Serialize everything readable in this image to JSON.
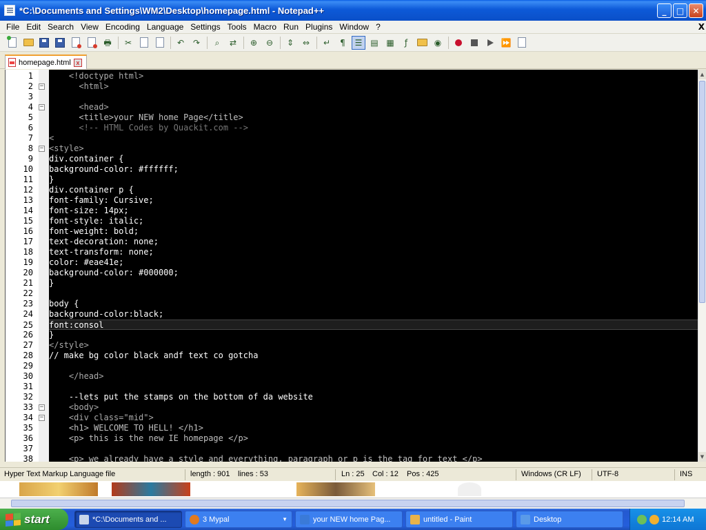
{
  "window": {
    "title": "*C:\\Documents and Settings\\WM2\\Desktop\\homepage.html - Notepad++",
    "min_glyph": "_",
    "max_glyph": "□",
    "close_glyph": "✕"
  },
  "menu": {
    "items": [
      "File",
      "Edit",
      "Search",
      "View",
      "Encoding",
      "Language",
      "Settings",
      "Tools",
      "Macro",
      "Run",
      "Plugins",
      "Window",
      "?"
    ],
    "close_glyph": "X"
  },
  "tab": {
    "label": "homepage.html",
    "close_glyph": "x"
  },
  "editor": {
    "lines": [
      {
        "n": "1",
        "fold": "",
        "text": "    <!doctype html>",
        "cls": "tag"
      },
      {
        "n": "2",
        "fold": "−",
        "text": "      <html>",
        "cls": "tag"
      },
      {
        "n": "3",
        "fold": "",
        "text": "      ",
        "cls": ""
      },
      {
        "n": "4",
        "fold": "−",
        "text": "      <head>",
        "cls": "tag"
      },
      {
        "n": "5",
        "fold": "",
        "text": "      <title>your NEW home Page</title>",
        "cls": "mix-title"
      },
      {
        "n": "6",
        "fold": "",
        "text": "      <!-- HTML Codes by Quackit.com -->",
        "cls": "cmt"
      },
      {
        "n": "7",
        "fold": "",
        "text": "<",
        "cls": "tag"
      },
      {
        "n": "8",
        "fold": "−",
        "text": "<style>",
        "cls": "tag"
      },
      {
        "n": "9",
        "fold": "",
        "text": "div.container {",
        "cls": ""
      },
      {
        "n": "10",
        "fold": "",
        "text": "background-color: #ffffff;",
        "cls": ""
      },
      {
        "n": "11",
        "fold": "",
        "text": "}",
        "cls": ""
      },
      {
        "n": "12",
        "fold": "",
        "text": "div.container p {",
        "cls": ""
      },
      {
        "n": "13",
        "fold": "",
        "text": "font-family: Cursive;",
        "cls": ""
      },
      {
        "n": "14",
        "fold": "",
        "text": "font-size: 14px;",
        "cls": ""
      },
      {
        "n": "15",
        "fold": "",
        "text": "font-style: italic;",
        "cls": ""
      },
      {
        "n": "16",
        "fold": "",
        "text": "font-weight: bold;",
        "cls": ""
      },
      {
        "n": "17",
        "fold": "",
        "text": "text-decoration: none;",
        "cls": ""
      },
      {
        "n": "18",
        "fold": "",
        "text": "text-transform: none;",
        "cls": ""
      },
      {
        "n": "19",
        "fold": "",
        "text": "color: #eae41e;",
        "cls": ""
      },
      {
        "n": "20",
        "fold": "",
        "text": "background-color: #000000;",
        "cls": ""
      },
      {
        "n": "21",
        "fold": "",
        "text": "}",
        "cls": ""
      },
      {
        "n": "22",
        "fold": "",
        "text": "",
        "cls": ""
      },
      {
        "n": "23",
        "fold": "",
        "text": "body {",
        "cls": ""
      },
      {
        "n": "24",
        "fold": "",
        "text": "background-color:black;",
        "cls": ""
      },
      {
        "n": "25",
        "fold": "",
        "text": "font:consol",
        "cls": "",
        "current": true
      },
      {
        "n": "26",
        "fold": "",
        "text": "}",
        "cls": ""
      },
      {
        "n": "27",
        "fold": "",
        "text": "</style>",
        "cls": "tag"
      },
      {
        "n": "28",
        "fold": "",
        "text": "// make bg color black andf text co gotcha",
        "cls": ""
      },
      {
        "n": "29",
        "fold": "",
        "text": "",
        "cls": ""
      },
      {
        "n": "30",
        "fold": "",
        "text": "    </head>",
        "cls": "tag"
      },
      {
        "n": "31",
        "fold": "",
        "text": "",
        "cls": ""
      },
      {
        "n": "32",
        "fold": "",
        "text": "    --lets put the stamps on the bottom of da website",
        "cls": ""
      },
      {
        "n": "33",
        "fold": "−",
        "text": "    <body>",
        "cls": "tag"
      },
      {
        "n": "34",
        "fold": "−",
        "text": "    <div class=\"mid\">",
        "cls": "tag"
      },
      {
        "n": "35",
        "fold": "",
        "text": "    <h1> WELCOME TO HELL! </h1>",
        "cls": "mix-h1"
      },
      {
        "n": "36",
        "fold": "",
        "text": "    <p> this is the new IE homepage </p>",
        "cls": "mix-p"
      },
      {
        "n": "37",
        "fold": "",
        "text": "",
        "cls": ""
      },
      {
        "n": "38",
        "fold": "",
        "text": "    <p> we already have a style and everything, paragraph or p is the tag for text </p>",
        "cls": "mix-p"
      }
    ]
  },
  "status": {
    "file_type": "Hyper Text Markup Language file",
    "length": "length : 901",
    "lines": "lines : 53",
    "ln": "Ln : 25",
    "col": "Col : 12",
    "pos": "Pos : 425",
    "eol": "Windows (CR LF)",
    "encoding": "UTF-8",
    "mode": "INS"
  },
  "taskbar": {
    "start_label": "start",
    "tasks": [
      {
        "label": "*C:\\Documents and ...",
        "icon_color": "#c9d6ea",
        "active": true
      },
      {
        "label": "3 Mypal",
        "icon_color": "#e07a20",
        "active": false,
        "dropdown": true
      },
      {
        "label": "your NEW home Pag...",
        "icon_color": "#3a7ad8",
        "active": false
      },
      {
        "label": "untitled - Paint",
        "icon_color": "#e8b34a",
        "active": false
      },
      {
        "label": "Desktop",
        "icon_color": "#5a9ae8",
        "active": false
      }
    ],
    "clock": "12:14 AM"
  },
  "colors": {
    "titlebar": "#0a4fc8",
    "editor_bg": "#000000",
    "taskbar": "#245edb",
    "start": "#2e8c2e"
  }
}
